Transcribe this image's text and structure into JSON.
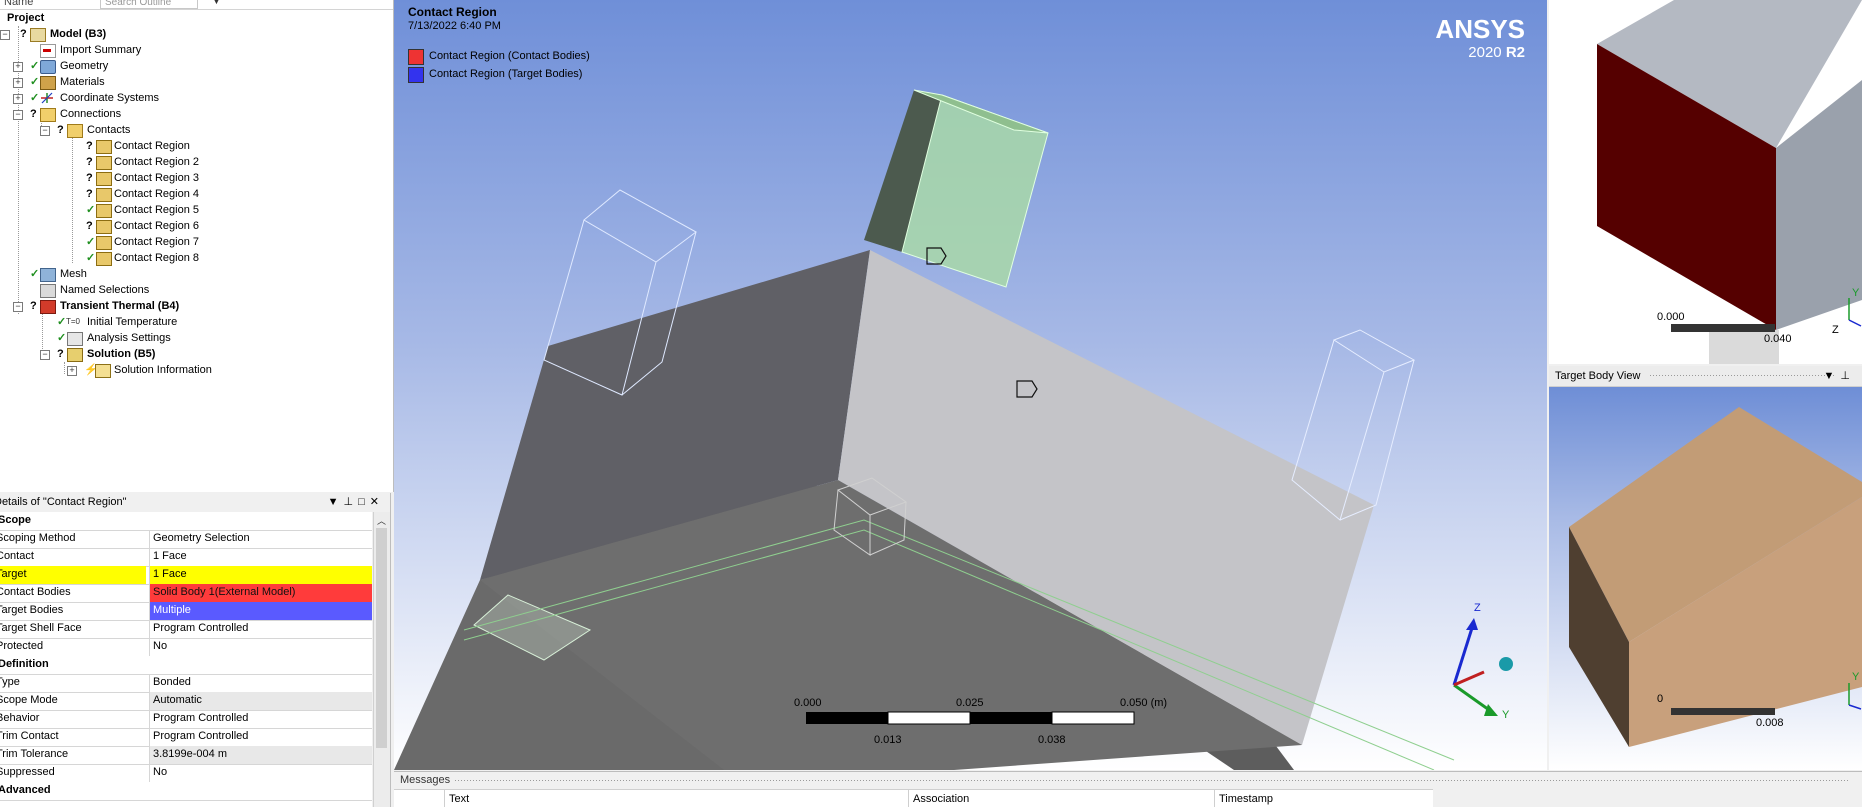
{
  "outline": {
    "name_col": "Name",
    "search_placeholder": "Search Outline",
    "items": [
      {
        "label": "Project"
      },
      {
        "label": "Model (B3)"
      },
      {
        "label": "Import Summary"
      },
      {
        "label": "Geometry"
      },
      {
        "label": "Materials"
      },
      {
        "label": "Coordinate Systems"
      },
      {
        "label": "Connections"
      },
      {
        "label": "Contacts"
      },
      {
        "label": "Contact Region"
      },
      {
        "label": "Contact Region 2"
      },
      {
        "label": "Contact Region 3"
      },
      {
        "label": "Contact Region 4"
      },
      {
        "label": "Contact Region 5"
      },
      {
        "label": "Contact Region 6"
      },
      {
        "label": "Contact Region 7"
      },
      {
        "label": "Contact Region 8"
      },
      {
        "label": "Mesh"
      },
      {
        "label": "Named Selections"
      },
      {
        "label": "Transient Thermal (B4)"
      },
      {
        "label": "Initial Temperature"
      },
      {
        "label": "Analysis Settings"
      },
      {
        "label": "Solution (B5)"
      },
      {
        "label": "Solution Information"
      }
    ]
  },
  "details": {
    "title": "Details of \"Contact Region\"",
    "rows": [
      {
        "key": "Scope",
        "value": ""
      },
      {
        "key": "Scoping Method",
        "value": "Geometry Selection"
      },
      {
        "key": "Contact",
        "value": "1 Face"
      },
      {
        "key": "Target",
        "value": "1 Face"
      },
      {
        "key": "Contact Bodies",
        "value": "Solid Body 1(External Model)"
      },
      {
        "key": "Target Bodies",
        "value": "Multiple"
      },
      {
        "key": "Target Shell Face",
        "value": "Program Controlled"
      },
      {
        "key": "Protected",
        "value": "No"
      },
      {
        "key": "Definition",
        "value": ""
      },
      {
        "key": "Type",
        "value": "Bonded"
      },
      {
        "key": "Scope Mode",
        "value": "Automatic"
      },
      {
        "key": "Behavior",
        "value": "Program Controlled"
      },
      {
        "key": "Trim Contact",
        "value": "Program Controlled"
      },
      {
        "key": "Trim Tolerance",
        "value": "3.8199e-004 m"
      },
      {
        "key": "Suppressed",
        "value": "No"
      },
      {
        "key": "Advanced",
        "value": ""
      }
    ]
  },
  "viewport": {
    "title": "Contact Region",
    "date": "7/13/2022 6:40 PM",
    "legend": [
      {
        "label": "Contact Region (Contact Bodies)",
        "color": "#ee3333"
      },
      {
        "label": "Contact Region (Target Bodies)",
        "color": "#3333ee"
      }
    ],
    "brand_name": "ANSYS",
    "brand_version_a": "2020",
    "brand_version_b": "R2",
    "scale_top": [
      "0.000",
      "0.025",
      "0.050 (m)"
    ],
    "scale_bottom": [
      "0.013",
      "0.038"
    ],
    "axis_z": "Z",
    "axis_y": "Y"
  },
  "contact_view": {
    "scale_left": "0.000",
    "scale_right": "0.040",
    "axis_y": "Y",
    "axis_z": "Z"
  },
  "target_view": {
    "title": "Target Body View",
    "scale_left": "0",
    "scale_right": "0.008",
    "axis_y": "Y"
  },
  "messages": {
    "title": "Messages",
    "columns": [
      "Text",
      "Association",
      "Timestamp"
    ]
  },
  "colors": {
    "contact": "#ee3333",
    "target": "#3333ee",
    "highlight": "#ffff00"
  }
}
